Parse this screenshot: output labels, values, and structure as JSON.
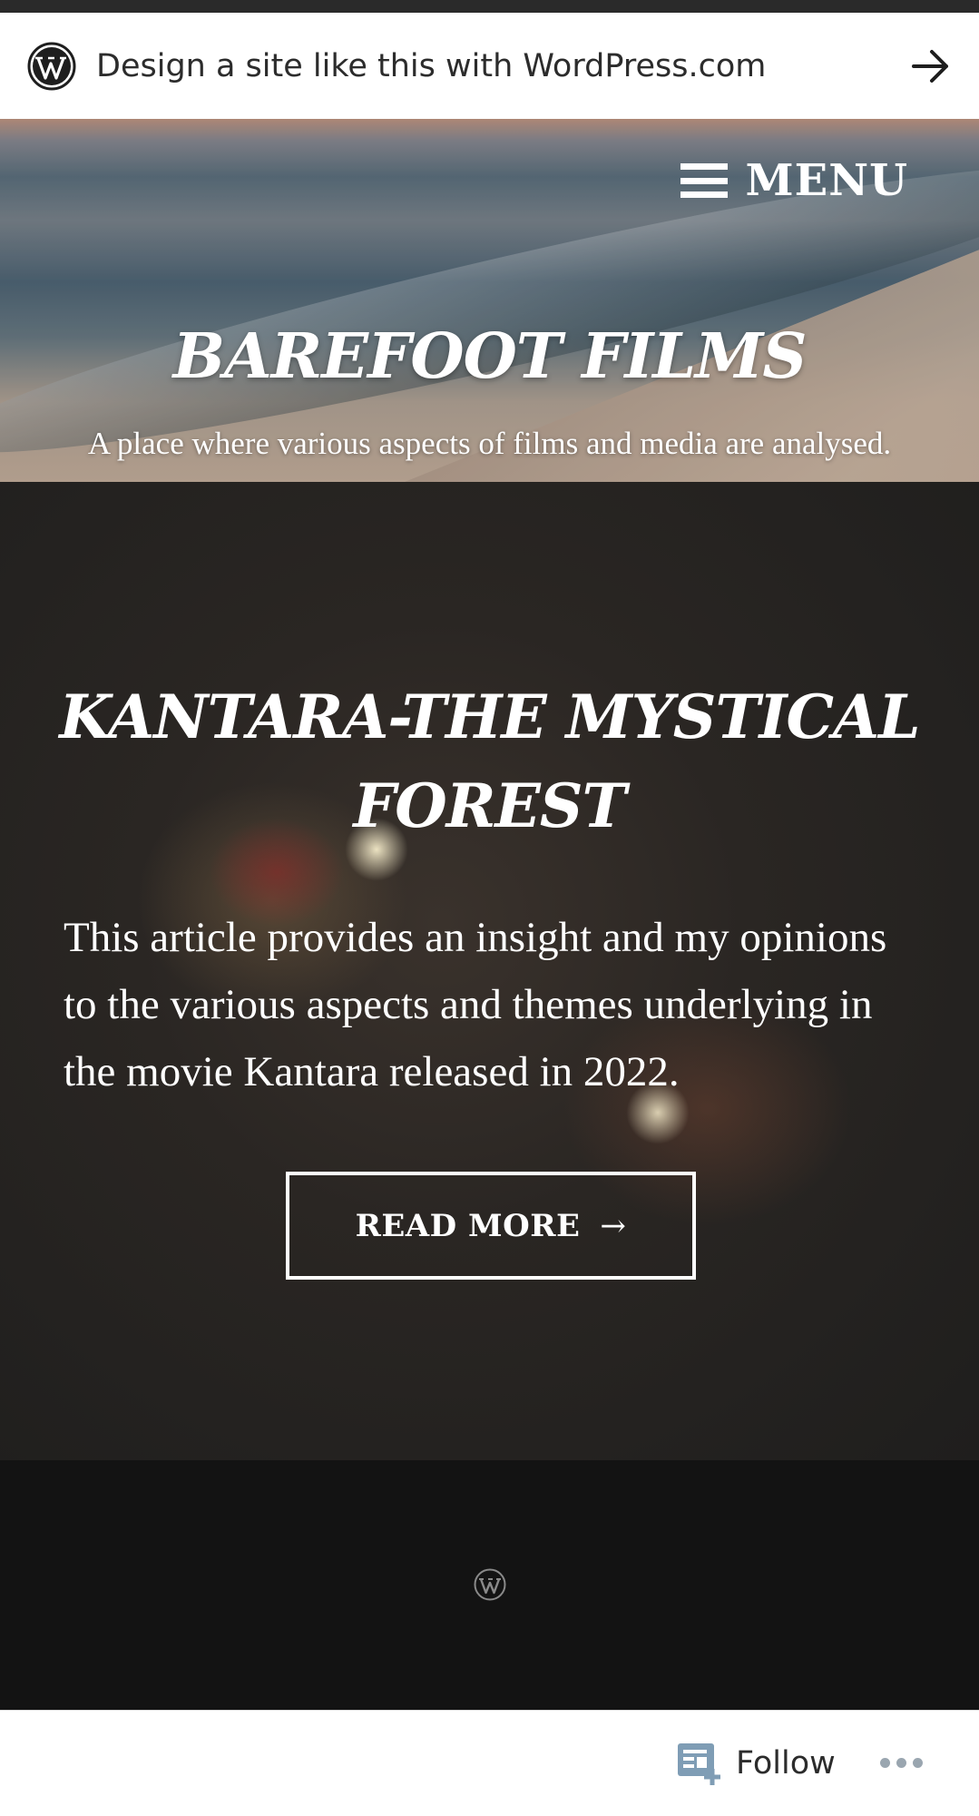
{
  "promo_bar": {
    "text": "Design a site like this with WordPress.com"
  },
  "header": {
    "menu_label": "MENU",
    "site_title": "BAREFOOT FILMS",
    "tagline": "A place where various aspects of films and media are analysed."
  },
  "post": {
    "title": "KANTARA-THE MYSTICAL FOREST",
    "excerpt": "This article provides an insight and my opinions to the various aspects and themes underlying in the movie Kantara released in 2022.",
    "read_more_label": "READ MORE",
    "read_more_arrow": "→"
  },
  "follow_bar": {
    "follow_label": "Follow"
  },
  "icons": {
    "promo_logo": "wordpress-logo-icon",
    "promo_arrow": "arrow-right-icon",
    "menu": "hamburger-icon",
    "footer_logo": "wordpress-logo-icon",
    "follow": "follow-reader-icon",
    "more": "more-dots-icon"
  },
  "colors": {
    "follow_icon": "#7f9db5",
    "more_dots": "#9aa6b0",
    "footer_bg": "#131313"
  }
}
